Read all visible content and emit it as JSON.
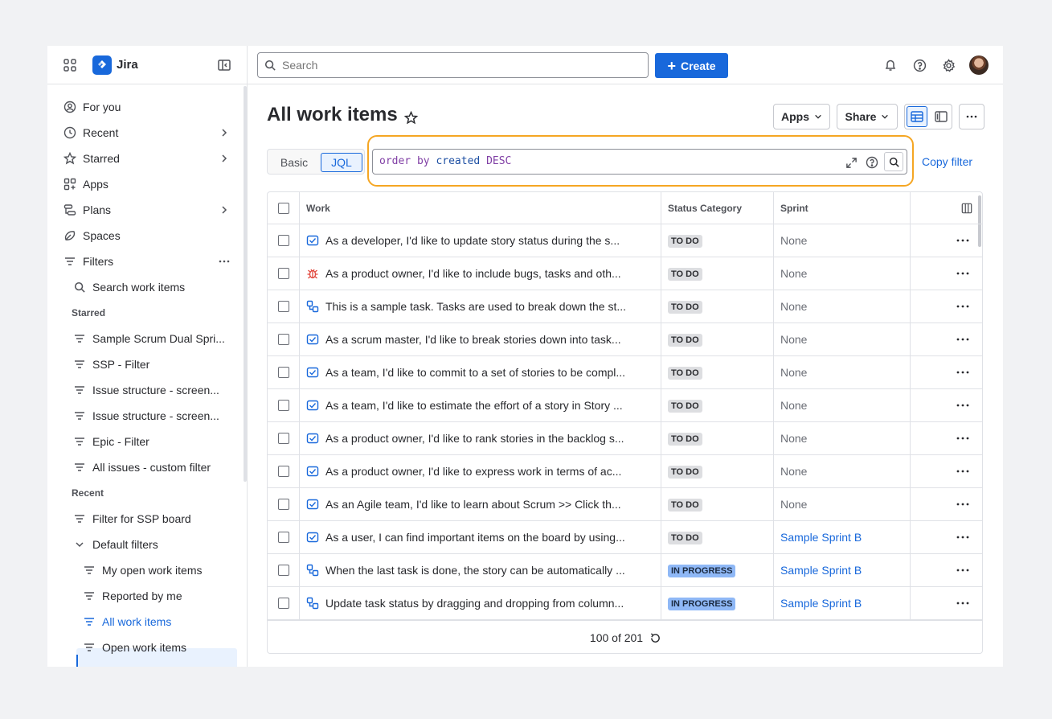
{
  "app": {
    "name": "Jira"
  },
  "topbar": {
    "search_placeholder": "Search",
    "create_label": "Create"
  },
  "sidebar": {
    "main_items": [
      {
        "label": "For you"
      },
      {
        "label": "Recent"
      },
      {
        "label": "Starred"
      },
      {
        "label": "Apps"
      },
      {
        "label": "Plans"
      },
      {
        "label": "Spaces"
      },
      {
        "label": "Filters"
      }
    ],
    "search_work_items": "Search work items",
    "starred_heading": "Starred",
    "starred_filters": [
      "Sample Scrum Dual Spri...",
      "SSP - Filter",
      "Issue structure - screen...",
      "Issue structure - screen...",
      "Epic - Filter",
      "All issues - custom filter"
    ],
    "recent_heading": "Recent",
    "recent_filter": "Filter for SSP board",
    "default_filters_label": "Default filters",
    "default_filters": [
      "My open work items",
      "Reported by me",
      "All work items",
      "Open work items"
    ]
  },
  "page": {
    "title": "All work items",
    "apps_button": "Apps",
    "share_button": "Share",
    "mode_basic": "Basic",
    "mode_jql": "JQL",
    "jql": {
      "kw1": "order by",
      "field": "created",
      "dir": "DESC"
    },
    "copy_filter": "Copy filter"
  },
  "table": {
    "headers": {
      "work": "Work",
      "status": "Status Category",
      "sprint": "Sprint"
    },
    "rows": [
      {
        "type": "story",
        "title": "As a developer, I'd like to update story status during the s...",
        "status": "TO DO",
        "sprint": "None"
      },
      {
        "type": "bug",
        "title": "As a product owner, I'd like to include bugs, tasks and oth...",
        "status": "TO DO",
        "sprint": "None"
      },
      {
        "type": "subtask",
        "title": "This is a sample task. Tasks are used to break down the st...",
        "status": "TO DO",
        "sprint": "None"
      },
      {
        "type": "story",
        "title": "As a scrum master, I'd like to break stories down into task...",
        "status": "TO DO",
        "sprint": "None"
      },
      {
        "type": "story",
        "title": "As a team, I'd like to commit to a set of stories to be compl...",
        "status": "TO DO",
        "sprint": "None"
      },
      {
        "type": "story",
        "title": "As a team, I'd like to estimate the effort of a story in Story ...",
        "status": "TO DO",
        "sprint": "None"
      },
      {
        "type": "story",
        "title": "As a product owner, I'd like to rank stories in the backlog s...",
        "status": "TO DO",
        "sprint": "None"
      },
      {
        "type": "story",
        "title": "As a product owner, I'd like to express work in terms of ac...",
        "status": "TO DO",
        "sprint": "None"
      },
      {
        "type": "story",
        "title": "As an Agile team, I'd like to learn about Scrum >> Click th...",
        "status": "TO DO",
        "sprint": "None"
      },
      {
        "type": "story",
        "title": "As a user, I can find important items on the board by using...",
        "status": "TO DO",
        "sprint": "Sample Sprint B"
      },
      {
        "type": "subtask",
        "title": "When the last task is done, the story can be automatically ...",
        "status": "IN PROGRESS",
        "sprint": "Sample Sprint B"
      },
      {
        "type": "subtask",
        "title": "Update task status by dragging and dropping from column...",
        "status": "IN PROGRESS",
        "sprint": "Sample Sprint B"
      }
    ],
    "footer_count": "100 of 201"
  },
  "colors": {
    "accent": "#1868db",
    "highlight_ring": "#f5a623",
    "bug": "#e2483d"
  }
}
